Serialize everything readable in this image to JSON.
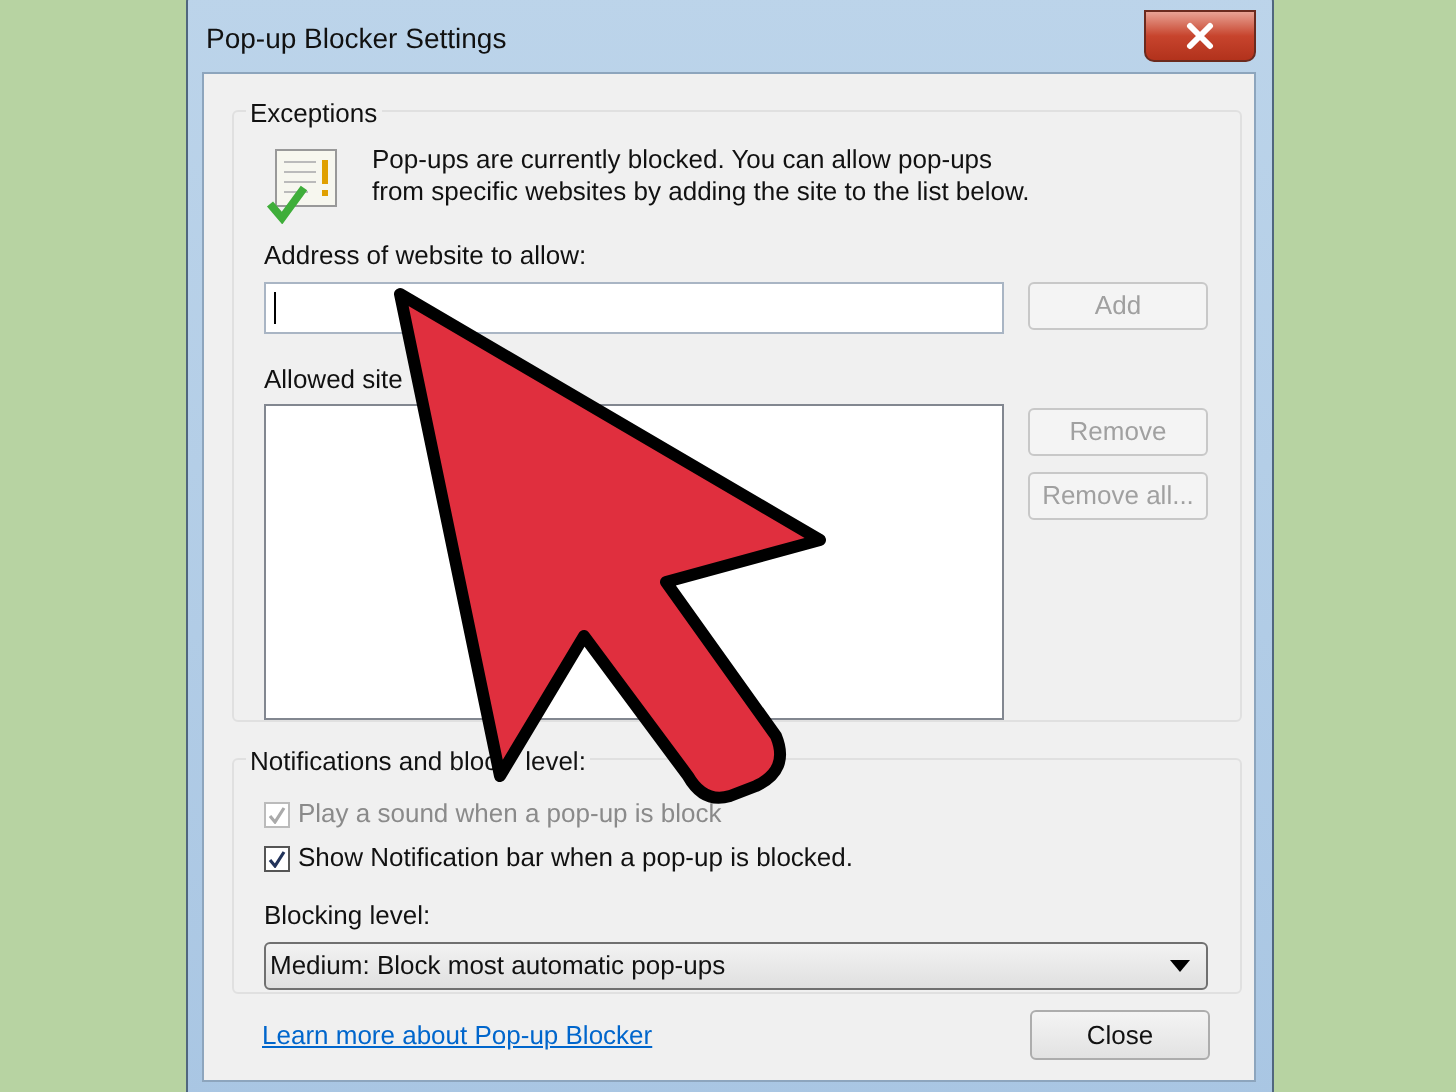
{
  "window": {
    "title": "Pop-up Blocker Settings"
  },
  "exceptions": {
    "heading": "Exceptions",
    "message": "Pop-ups are currently blocked.  You can allow pop-ups from specific websites by adding the site to the list below.",
    "address_label": "Address of website to allow:",
    "add_button": {
      "label": "Add",
      "disabled": true
    },
    "allowed_label": "Allowed site",
    "buttons": [
      {
        "label": "Remove",
        "disabled": true
      },
      {
        "label": "Remove all...",
        "disabled": true
      }
    ]
  },
  "notifications": {
    "heading_parts": [
      "Notifications and bloc",
      "level:"
    ],
    "options": [
      {
        "label": "Play a sound when a pop-up is block",
        "checked": true,
        "disabled": true
      },
      {
        "label": "Show Notification bar when a pop-up is blocked.",
        "checked": true,
        "disabled": false
      }
    ],
    "blocking_label": "Blocking level:",
    "blocking_select": {
      "value": "Medium: Block most automatic pop-ups"
    }
  },
  "footer": {
    "link": "Learn more about Pop-up Blocker",
    "close_button": {
      "label": "Close",
      "disabled": false
    }
  }
}
